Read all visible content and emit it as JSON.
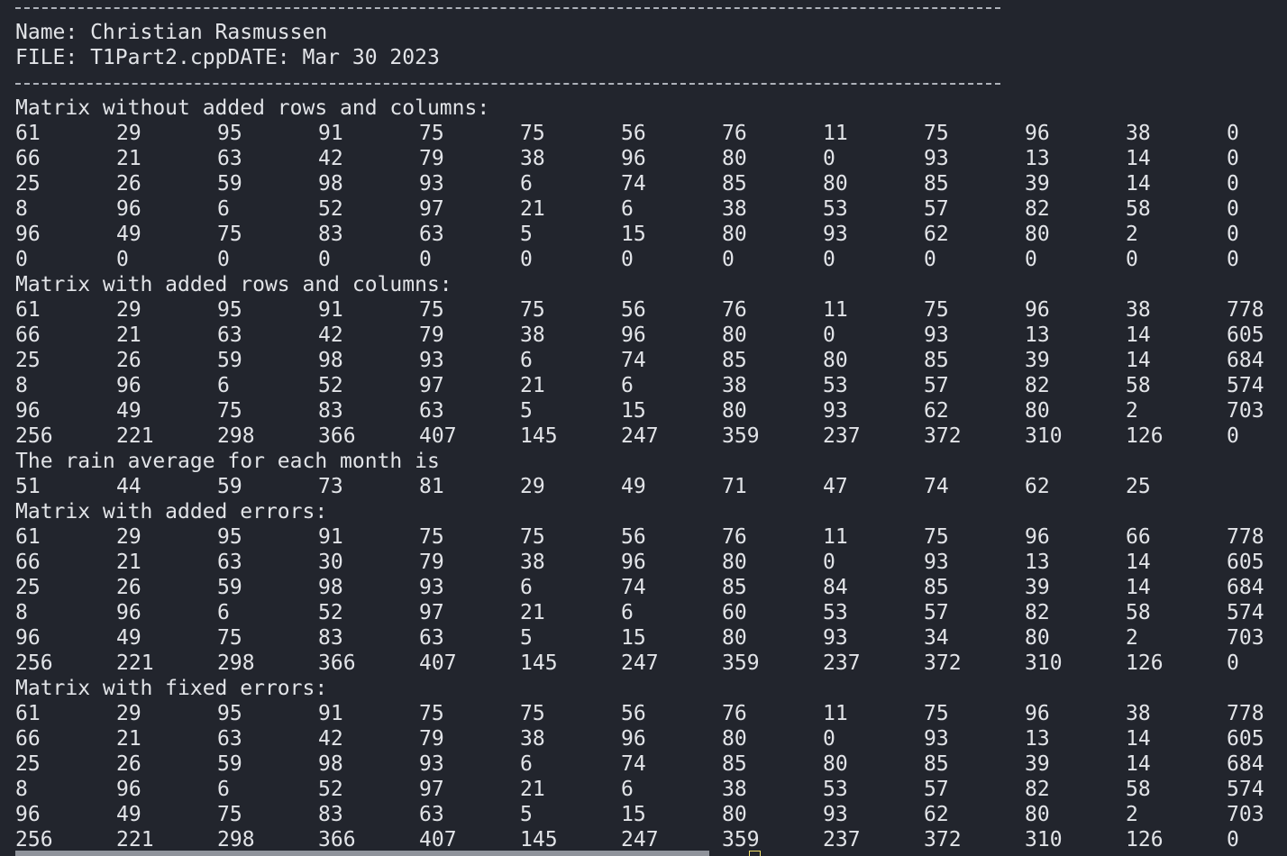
{
  "header": {
    "name_line": "Name: Christian Rasmussen",
    "file_line": "FILE: T1Part2.cppDATE: Mar 30 2023"
  },
  "sections": [
    {
      "label": "Matrix without added rows and columns:",
      "rows": [
        [
          "61",
          "29",
          "95",
          "91",
          "75",
          "75",
          "56",
          "76",
          "11",
          "75",
          "96",
          "38",
          "0"
        ],
        [
          "66",
          "21",
          "63",
          "42",
          "79",
          "38",
          "96",
          "80",
          "0",
          "93",
          "13",
          "14",
          "0"
        ],
        [
          "25",
          "26",
          "59",
          "98",
          "93",
          "6",
          "74",
          "85",
          "80",
          "85",
          "39",
          "14",
          "0"
        ],
        [
          "8",
          "96",
          "6",
          "52",
          "97",
          "21",
          "6",
          "38",
          "53",
          "57",
          "82",
          "58",
          "0"
        ],
        [
          "96",
          "49",
          "75",
          "83",
          "63",
          "5",
          "15",
          "80",
          "93",
          "62",
          "80",
          "2",
          "0"
        ],
        [
          "0",
          "0",
          "0",
          "0",
          "0",
          "0",
          "0",
          "0",
          "0",
          "0",
          "0",
          "0",
          "0"
        ]
      ]
    },
    {
      "label": "Matrix with added rows and columns:",
      "rows": [
        [
          "61",
          "29",
          "95",
          "91",
          "75",
          "75",
          "56",
          "76",
          "11",
          "75",
          "96",
          "38",
          "778"
        ],
        [
          "66",
          "21",
          "63",
          "42",
          "79",
          "38",
          "96",
          "80",
          "0",
          "93",
          "13",
          "14",
          "605"
        ],
        [
          "25",
          "26",
          "59",
          "98",
          "93",
          "6",
          "74",
          "85",
          "80",
          "85",
          "39",
          "14",
          "684"
        ],
        [
          "8",
          "96",
          "6",
          "52",
          "97",
          "21",
          "6",
          "38",
          "53",
          "57",
          "82",
          "58",
          "574"
        ],
        [
          "96",
          "49",
          "75",
          "83",
          "63",
          "5",
          "15",
          "80",
          "93",
          "62",
          "80",
          "2",
          "703"
        ],
        [
          "256",
          "221",
          "298",
          "366",
          "407",
          "145",
          "247",
          "359",
          "237",
          "372",
          "310",
          "126",
          "0"
        ]
      ]
    },
    {
      "label": "The rain average for each month is",
      "rows": [
        [
          "51",
          "44",
          "59",
          "73",
          "81",
          "29",
          "49",
          "71",
          "47",
          "74",
          "62",
          "25"
        ]
      ]
    },
    {
      "label": "Matrix with added errors:",
      "rows": [
        [
          "61",
          "29",
          "95",
          "91",
          "75",
          "75",
          "56",
          "76",
          "11",
          "75",
          "96",
          "66",
          "778"
        ],
        [
          "66",
          "21",
          "63",
          "30",
          "79",
          "38",
          "96",
          "80",
          "0",
          "93",
          "13",
          "14",
          "605"
        ],
        [
          "25",
          "26",
          "59",
          "98",
          "93",
          "6",
          "74",
          "85",
          "84",
          "85",
          "39",
          "14",
          "684"
        ],
        [
          "8",
          "96",
          "6",
          "52",
          "97",
          "21",
          "6",
          "60",
          "53",
          "57",
          "82",
          "58",
          "574"
        ],
        [
          "96",
          "49",
          "75",
          "83",
          "63",
          "5",
          "15",
          "80",
          "93",
          "34",
          "80",
          "2",
          "703"
        ],
        [
          "256",
          "221",
          "298",
          "366",
          "407",
          "145",
          "247",
          "359",
          "237",
          "372",
          "310",
          "126",
          "0"
        ]
      ]
    },
    {
      "label": "Matrix with fixed errors:",
      "rows": [
        [
          "61",
          "29",
          "95",
          "91",
          "75",
          "75",
          "56",
          "76",
          "11",
          "75",
          "96",
          "38",
          "778"
        ],
        [
          "66",
          "21",
          "63",
          "42",
          "79",
          "38",
          "96",
          "80",
          "0",
          "93",
          "13",
          "14",
          "605"
        ],
        [
          "25",
          "26",
          "59",
          "98",
          "93",
          "6",
          "74",
          "85",
          "80",
          "85",
          "39",
          "14",
          "684"
        ],
        [
          "8",
          "96",
          "6",
          "52",
          "97",
          "21",
          "6",
          "38",
          "53",
          "57",
          "82",
          "58",
          "574"
        ],
        [
          "96",
          "49",
          "75",
          "83",
          "63",
          "5",
          "15",
          "80",
          "93",
          "62",
          "80",
          "2",
          "703"
        ],
        [
          "256",
          "221",
          "298",
          "366",
          "407",
          "145",
          "247",
          "359",
          "237",
          "372",
          "310",
          "126",
          "0"
        ]
      ]
    }
  ]
}
